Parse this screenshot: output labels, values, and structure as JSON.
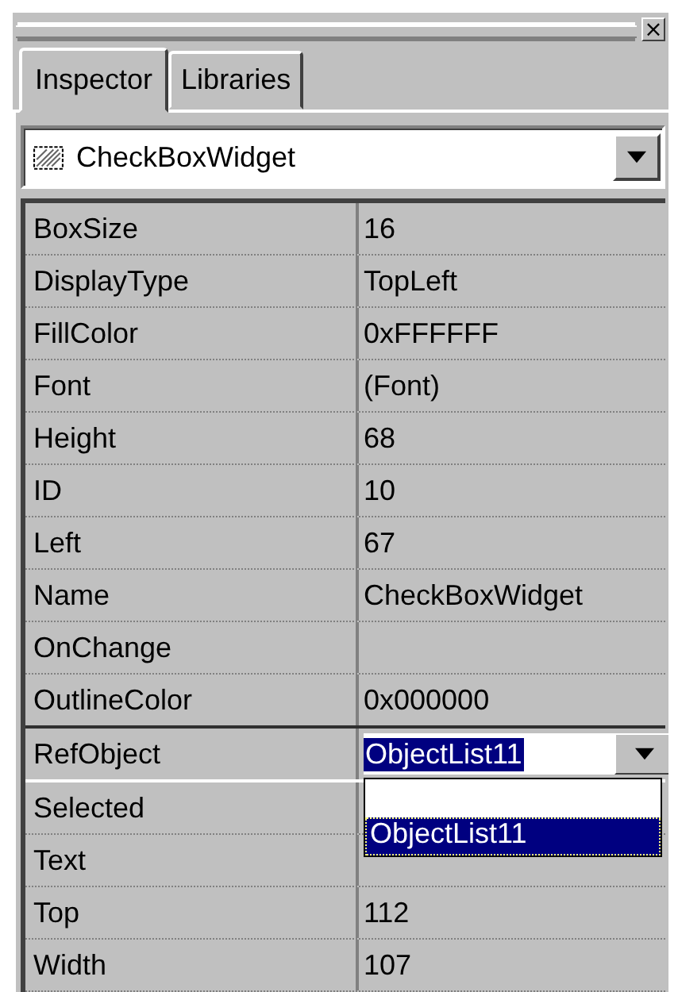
{
  "panel": {
    "close_glyph": "×"
  },
  "tabs": [
    {
      "label": "Inspector",
      "selected": true
    },
    {
      "label": "Libraries",
      "selected": false
    }
  ],
  "object_selector": {
    "value": "CheckBoxWidget"
  },
  "properties": [
    {
      "name": "BoxSize",
      "value": "16",
      "selected": false
    },
    {
      "name": "DisplayType",
      "value": "TopLeft",
      "selected": false
    },
    {
      "name": "FillColor",
      "value": "0xFFFFFF",
      "selected": false
    },
    {
      "name": "Font",
      "value": "(Font)",
      "selected": false
    },
    {
      "name": "Height",
      "value": "68",
      "selected": false
    },
    {
      "name": "ID",
      "value": "10",
      "selected": false
    },
    {
      "name": "Left",
      "value": "67",
      "selected": false
    },
    {
      "name": "Name",
      "value": "CheckBoxWidget",
      "selected": false
    },
    {
      "name": "OnChange",
      "selected": false
    },
    {
      "name": "OutlineColor",
      "value": "0x000000",
      "selected": false
    },
    {
      "name": "RefObject",
      "value": "ObjectList11",
      "selected": true,
      "kind": "dropdown",
      "expanded": true,
      "options": [
        {
          "kind": "empty"
        },
        {
          "kind": "item",
          "label": "ObjectList11",
          "selected": true
        }
      ]
    },
    {
      "name": "Selected",
      "selected": false
    },
    {
      "name": "Text",
      "selected": false
    },
    {
      "name": "Top",
      "value": "112",
      "selected": false
    },
    {
      "name": "Width",
      "value": "107",
      "selected": false
    }
  ]
}
